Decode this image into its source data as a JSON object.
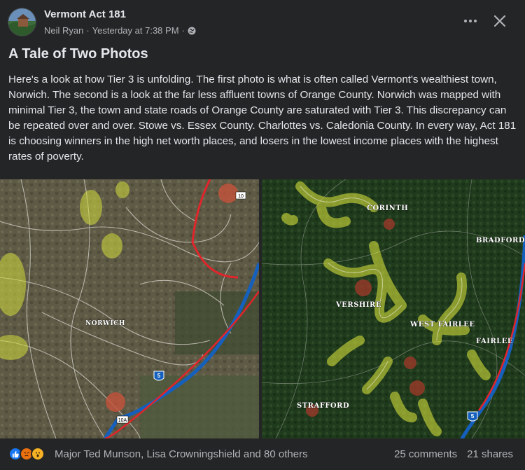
{
  "post": {
    "group_name": "Vermont Act 181",
    "author": "Neil Ryan",
    "separator": "·",
    "time": "Yesterday at 7:38 PM",
    "title": "A Tale of Two Photos",
    "body": "Here's a look at how Tier 3 is unfolding. The first photo is what is often called Vermont's wealthiest town, Norwich. The second is a look at the far less affluent towns of Orange County. Norwich was mapped with minimal Tier 3, the town and state roads of Orange County are saturated with Tier 3. This discrepancy can be repeated over and over. Stowe vs. Essex County. Charlottes vs. Caledonia County. In every way, Act 181 is choosing winners in the high net worth places, and losers in the lowest income places with the highest rates of poverty."
  },
  "map_left": {
    "town_label": "NORWICH",
    "shields": [
      "5",
      "10A",
      "10"
    ]
  },
  "map_right": {
    "town_labels": [
      "CORINTH",
      "BRADFORD",
      "VERSHIRE",
      "WEST FAIRLEE",
      "FAIRLEE",
      "STRAFFORD"
    ],
    "shield": "5"
  },
  "footer": {
    "reaction_names": "Major Ted Munson, Lisa Crowningshield and 80 others",
    "comments": "25 comments",
    "shares": "21 shares"
  },
  "icons": {
    "avatar": "group-avatar",
    "globe": "globe-icon",
    "more": "more-options-icon",
    "close": "close-icon",
    "like": "like-reaction-icon",
    "angry": "angry-reaction-icon",
    "wow": "wow-reaction-icon"
  },
  "colors": {
    "background": "#242526",
    "text_primary": "#e4e6eb",
    "text_secondary": "#b0b3b8",
    "like_blue": "#1877f2",
    "tier3_highlight": "#c8d24a",
    "state_road_red": "#e0252b",
    "interstate_blue": "#1560bd"
  }
}
